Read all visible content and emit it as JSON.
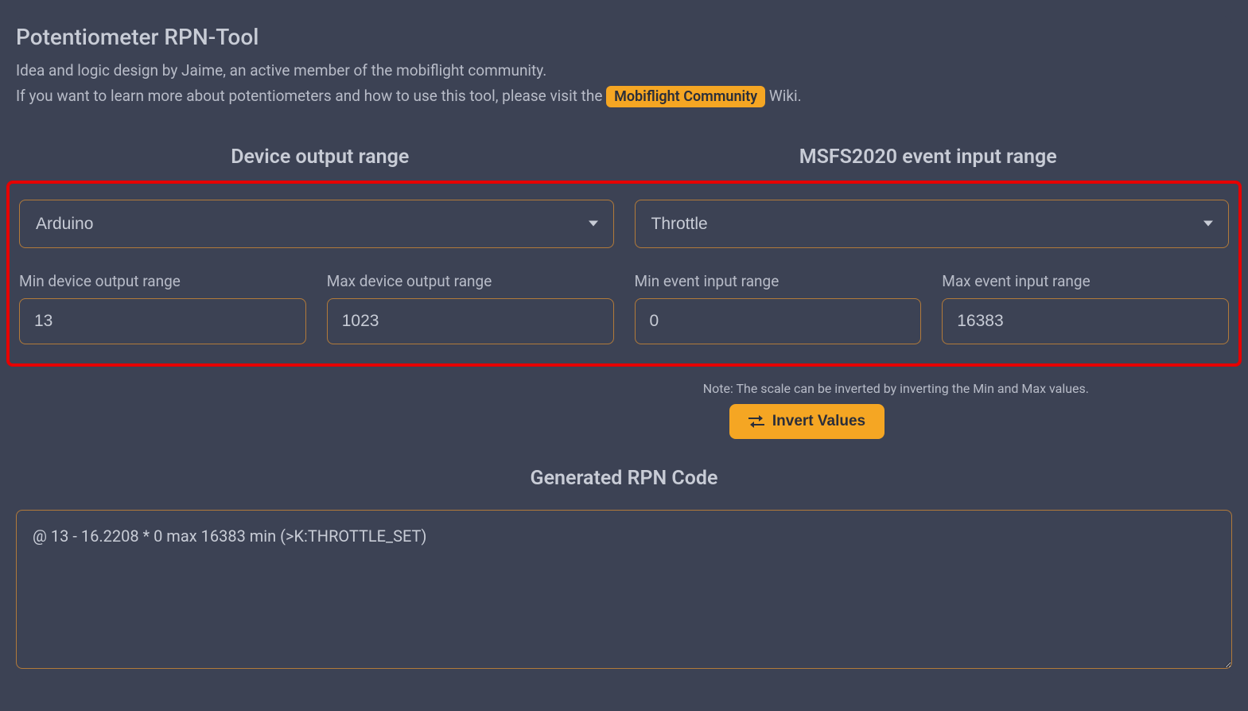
{
  "header": {
    "title": "Potentiometer RPN-Tool",
    "desc_line1": "Idea and logic design by Jaime, an active member of the mobiflight community.",
    "desc_line2_prefix": "If you want to learn more about potentiometers and how to use this tool, please visit the ",
    "wiki_link_label": "Mobiflight Community",
    "desc_line2_suffix": " Wiki."
  },
  "sections": {
    "device_heading": "Device output range",
    "event_heading": "MSFS2020 event input range"
  },
  "selects": {
    "device": {
      "selected": "Arduino"
    },
    "event": {
      "selected": "Throttle"
    }
  },
  "inputs": {
    "min_device": {
      "label": "Min device output range",
      "value": "13"
    },
    "max_device": {
      "label": "Max device output range",
      "value": "1023"
    },
    "min_event": {
      "label": "Min event input range",
      "value": "0"
    },
    "max_event": {
      "label": "Max event input range",
      "value": "16383"
    }
  },
  "note": "Note: The scale can be inverted by inverting the Min and Max values.",
  "invert_button": "Invert Values",
  "generated_heading": "Generated RPN Code",
  "generated_code": "@ 13 - 16.2208 * 0 max 16383 min (>K:THROTTLE_SET)"
}
